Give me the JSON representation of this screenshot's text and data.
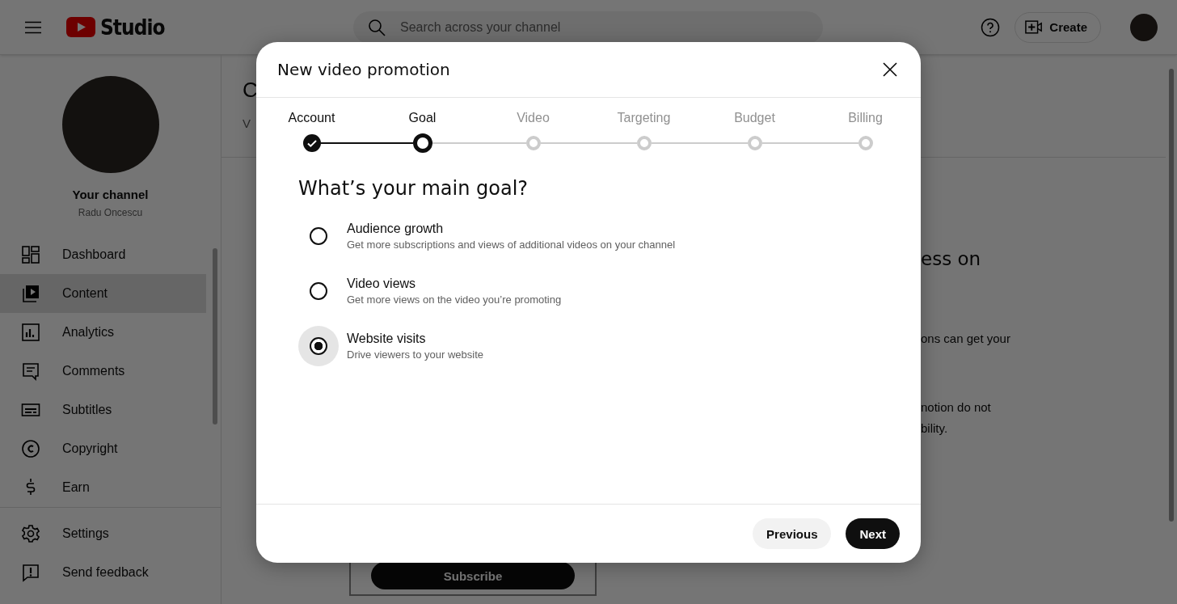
{
  "header": {
    "logo_text": "Studio",
    "search": {
      "placeholder": "Search across your channel"
    },
    "create_button": "Create"
  },
  "sidebar": {
    "channel_title": "Your channel",
    "channel_name": "Radu Oncescu",
    "items": [
      {
        "label": "Dashboard",
        "selected": false
      },
      {
        "label": "Content",
        "selected": true
      },
      {
        "label": "Analytics",
        "selected": false
      },
      {
        "label": "Comments",
        "selected": false
      },
      {
        "label": "Subtitles",
        "selected": false
      },
      {
        "label": "Copyright",
        "selected": false
      },
      {
        "label": "Earn",
        "selected": false
      }
    ],
    "bottom_items": [
      {
        "label": "Settings"
      },
      {
        "label": "Send feedback"
      }
    ]
  },
  "main": {
    "heading_partial": "C",
    "tab_partial": "V",
    "right_heading": "ess on",
    "right_lines": [
      "ons can get your",
      "notion do not",
      "bility."
    ],
    "subscribe_button": "Subscribe"
  },
  "dialog": {
    "title": "New video promotion",
    "steps": [
      {
        "label": "Account",
        "kind": "done"
      },
      {
        "label": "Goal",
        "kind": "current"
      },
      {
        "label": "Video",
        "kind": "upcoming"
      },
      {
        "label": "Targeting",
        "kind": "upcoming"
      },
      {
        "label": "Budget",
        "kind": "upcoming"
      },
      {
        "label": "Billing",
        "kind": "upcoming"
      }
    ],
    "question": "What’s your main goal?",
    "options": [
      {
        "title": "Audience growth",
        "description": "Get more subscriptions and views of additional videos on your channel",
        "selected": false
      },
      {
        "title": "Video views",
        "description": "Get more views on the video you’re promoting",
        "selected": false
      },
      {
        "title": "Website visits",
        "description": "Drive viewers to your website",
        "selected": true
      }
    ],
    "buttons": [
      {
        "label": "Previous",
        "kind": "secondary"
      },
      {
        "label": "Next",
        "kind": "primary"
      }
    ]
  }
}
